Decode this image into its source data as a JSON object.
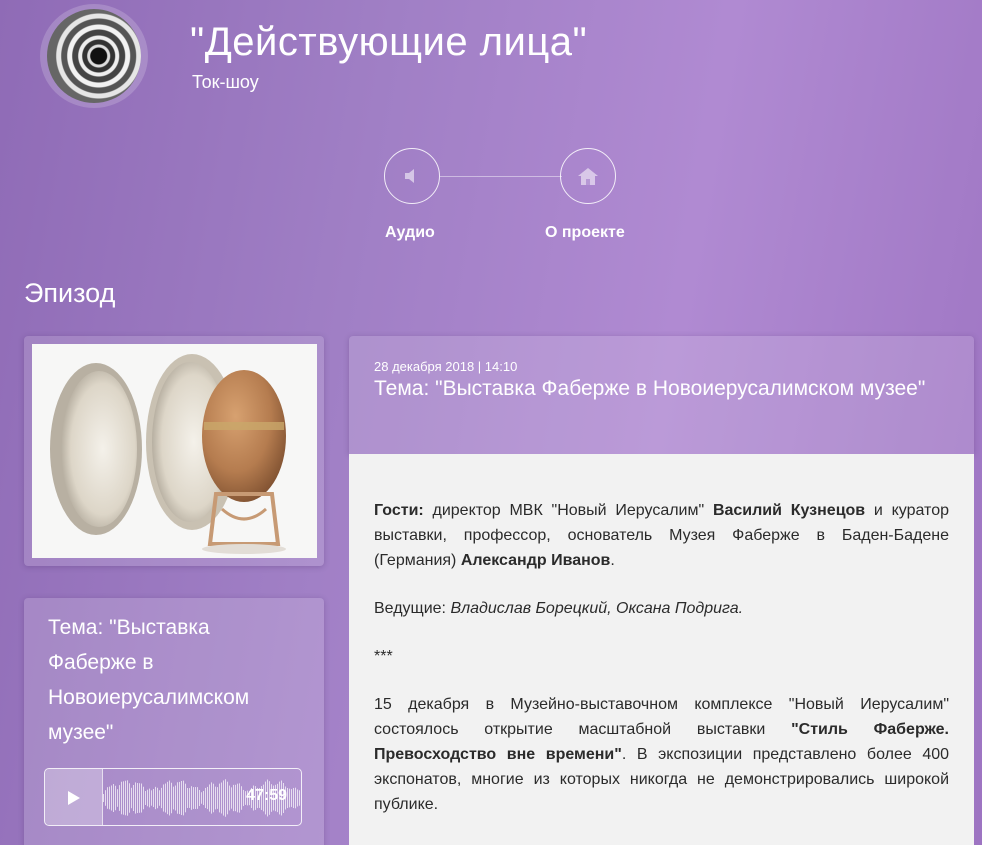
{
  "header": {
    "title": "\"Действующие лица\"",
    "subtitle": "Ток-шоу"
  },
  "nav": {
    "audio_label": "Аудио",
    "about_label": "О проекте",
    "audio_icon": "speaker-icon",
    "about_icon": "home-icon"
  },
  "episode": {
    "section_title": "Эпизод",
    "image_alt": "faberge-egg-image"
  },
  "player": {
    "topic": "Тема: \"Выставка Фаберже в Новоиерусалимском музее\"",
    "duration": "47:59",
    "play_icon": "play-icon"
  },
  "article": {
    "date": "28 декабря 2018 | 14:10",
    "topic": "Тема: \"Выставка Фаберже в Новоиерусалимском музее\"",
    "guests_label": "Гости:",
    "guests_text1": " директор МВК \"Новый Иерусалим\" ",
    "guest1": "Василий Кузнецов",
    "guests_text2": " и куратор выставки, профессор, основатель Музея Фаберже в Баден-Бадене (Германия) ",
    "guest2": "Александр Иванов",
    "guests_end": ".",
    "hosts_label": "Ведущие: ",
    "hosts": "Владислав Борецкий, Оксана Подрига.",
    "separator": "***",
    "body_text1": "15 декабря в Музейно-выставочном комплексе \"Новый Иерусалим\" состоялось открытие масштабной выставки ",
    "exhibit": "\"Стиль Фаберже. Превосходство вне времени\"",
    "body_text2": ". В экспозиции представлено более 400 экспонатов, многие из которых никогда не демонстрировались широкой публике."
  },
  "colors": {
    "bg_start": "#8f6bb6",
    "bg_mid": "#b08ad2",
    "content_bg": "#f2f2f2",
    "text_dark": "#2b2b2b"
  }
}
